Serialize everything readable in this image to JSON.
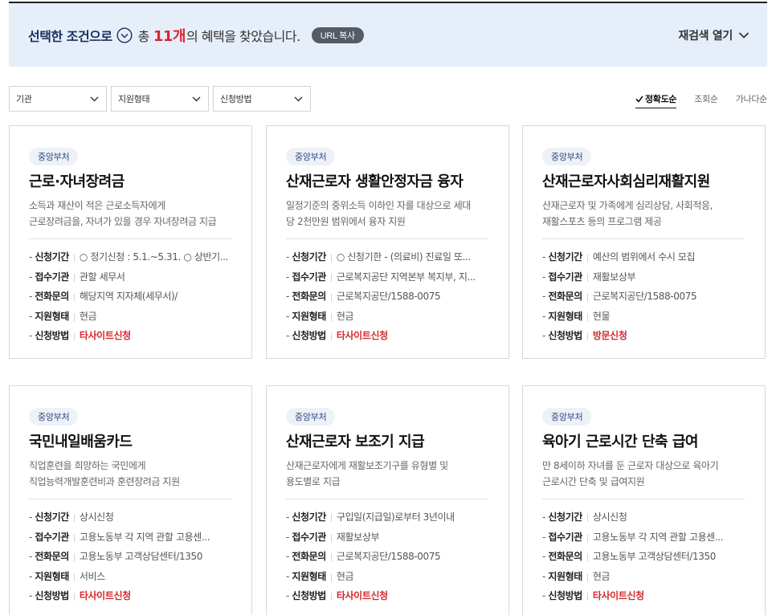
{
  "result": {
    "selected_label": "선택한 조건으로",
    "total_prefix": "총",
    "count": "11개",
    "suffix": "의 혜택을 찾았습니다.",
    "url_copy": "URL 복사",
    "research_label": "재검색 열기"
  },
  "filters": [
    {
      "label": "기관"
    },
    {
      "label": "지원형태"
    },
    {
      "label": "신청방법"
    }
  ],
  "sorts": [
    {
      "label": "정확도순",
      "active": true
    },
    {
      "label": "조회순",
      "active": false
    },
    {
      "label": "가나다순",
      "active": false
    }
  ],
  "field_labels": [
    "신청기간",
    "접수기관",
    "전화문의",
    "지원형태",
    "신청방법"
  ],
  "cards": [
    {
      "badge": "중앙부처",
      "title": "근로·자녀장려금",
      "desc1": "소득과 재산이 적은 근로소득자에게",
      "desc2": "근로장려금을, 자녀가 있을 경우 자녀장려금 지급",
      "period": "○ 정기신청 : 5.1.~5.31. ○ 상반기...",
      "agency": "관할 세무서",
      "phone": "해당지역 지자체(세무서)/",
      "type": "현금",
      "method": "타사이트신청"
    },
    {
      "badge": "중앙부처",
      "title": "산재근로자 생활안정자금 융자",
      "desc1": "일정기준의 중위소득 이하인 자를 대상으로 세대",
      "desc2": "당 2천만원 범위에서 융자 지원",
      "period": "○ 신청기한 - (의료비) 진료일 또...",
      "agency": "근로복지공단 지역본부 복지부, 지...",
      "phone": "근로복지공단/1588-0075",
      "type": "현금",
      "method": "타사이트신청"
    },
    {
      "badge": "중앙부처",
      "title": "산재근로자사회심리재활지원",
      "desc1": "산재근로자 및 가족에게 심리상담, 사회적응,",
      "desc2": "재활스포츠 등의 프로그램 제공",
      "period": "예산의 범위에서 수시 모집",
      "agency": "재활보상부",
      "phone": "근로복지공단/1588-0075",
      "type": "현물",
      "method": "방문신청"
    },
    {
      "badge": "중앙부처",
      "title": "국민내일배움카드",
      "desc1": "직업훈련을 희망하는 국민에게",
      "desc2": "직업능력개발훈련비과 훈련장려금 지원",
      "period": "상시신청",
      "agency": "고용노동부 각 지역 관할 고용센...",
      "phone": "고용노동부 고객상담센터/1350",
      "type": "서비스",
      "method": "타사이트신청"
    },
    {
      "badge": "중앙부처",
      "title": "산재근로자 보조기 지급",
      "desc1": "산재근로자에게 재활보조기구를 유형별 및",
      "desc2": "용도별로 지급",
      "period": "구입일(지급일)로부터 3년이내",
      "agency": "재활보상부",
      "phone": "근로복지공단/1588-0075",
      "type": "현금",
      "method": "타사이트신청"
    },
    {
      "badge": "중앙부처",
      "title": "육아기 근로시간 단축 급여",
      "desc1": "만 8세이하 자녀를 둔 근로자 대상으로 육아기",
      "desc2": "근로시간 단축 및 급여지원",
      "period": "상시신청",
      "agency": "고용노동부 각 지역 관할 고용센...",
      "phone": "고용노동부 고객상담센터/1350",
      "type": "현금",
      "method": "타사이트신청"
    }
  ],
  "colors": {
    "accent_red": "#d6282d",
    "navy": "#1b2f5b",
    "result_bg": "#e6eefa"
  }
}
